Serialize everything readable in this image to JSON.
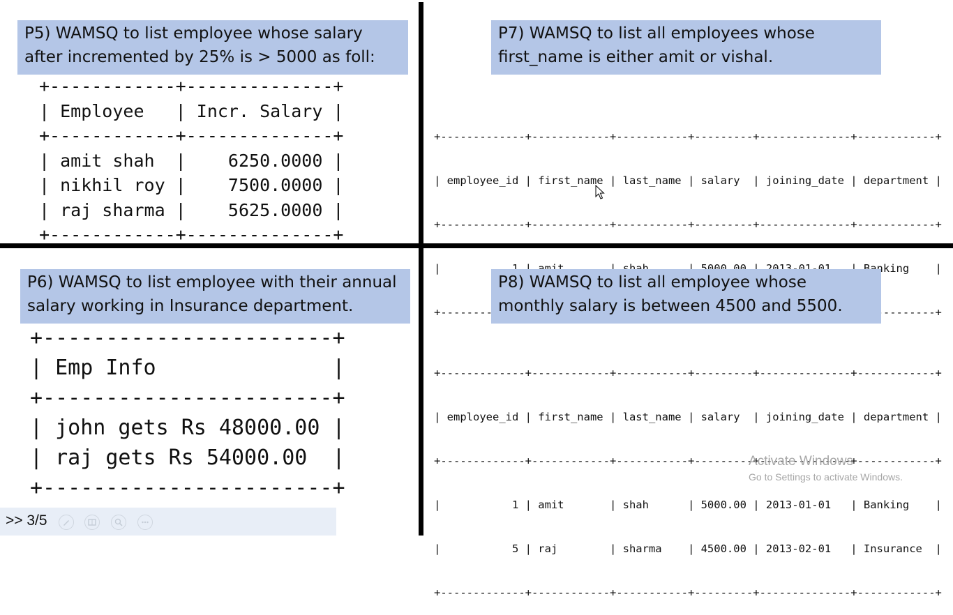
{
  "p5": {
    "lines": [
      "P5) WAMSQ to list employee whose salary",
      "after incremented by 25% is > 5000 as foll:"
    ],
    "border": "+------------+--------------+",
    "header": "| Employee   | Incr. Salary |",
    "rows": [
      "| amit shah  |    6250.0000 |",
      "| nikhil roy |    7500.0000 |",
      "| raj sharma |    5625.0000 |"
    ]
  },
  "p6": {
    "lines": [
      "P6) WAMSQ to list employee with their annual",
      "salary working in Insurance department."
    ],
    "border": "+-----------------------+",
    "header": "| Emp Info              |",
    "rows": [
      "| john gets Rs 48000.00 |",
      "| raj gets Rs 54000.00  |"
    ]
  },
  "p7": {
    "lines": [
      "P7) WAMSQ to list all employees whose",
      "first_name is either amit or vishal."
    ],
    "border": "+-------------+------------+-----------+---------+--------------+------------+",
    "header": "| employee_id | first_name | last_name | salary  | joining_date | department |",
    "rows": [
      "|           1 | amit       | shah      | 5000.00 | 2013-01-01   | Banking    |"
    ]
  },
  "p8": {
    "lines": [
      "P8) WAMSQ to list all employee whose",
      "monthly salary is between 4500 and 5500."
    ],
    "border": "+-------------+------------+-----------+---------+--------------+------------+",
    "header": "| employee_id | first_name | last_name | salary  | joining_date | department |",
    "rows": [
      "|           1 | amit       | shah      | 5000.00 | 2013-01-01   | Banking    |",
      "|           5 | raj        | sharma    | 4500.00 | 2013-02-01   | Insurance  |"
    ]
  },
  "presenter": {
    "counter": ">> 3/5",
    "controls": [
      "pen-icon",
      "slides-grid-icon",
      "zoom-icon",
      "more-icon"
    ]
  },
  "watermark": {
    "title": "Activate Windows",
    "subtitle": "Go to Settings to activate Windows."
  },
  "colors": {
    "question_bg": "#b4c6e7",
    "divider": "#000000",
    "presenter_bar": "#e8eef7"
  }
}
